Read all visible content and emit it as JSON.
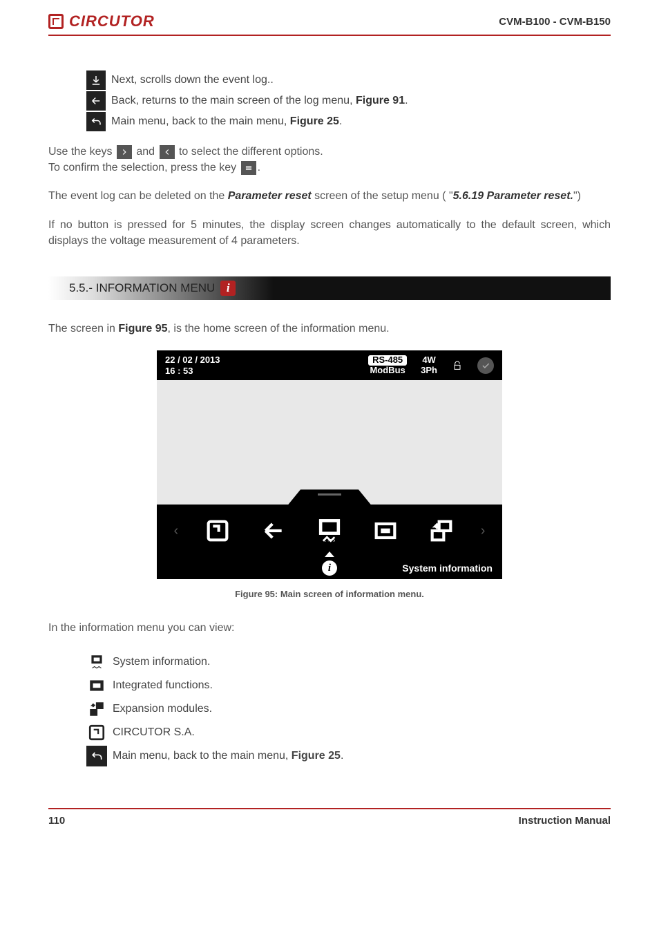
{
  "header": {
    "brand": "CIRCUTOR",
    "doc_id": "CVM-B100 - CVM-B150"
  },
  "icons_desc": {
    "next": " Next, scrolls down the event log..",
    "back_text_a": " Back, returns to the main screen of the log menu, ",
    "back_ref": "Figure 91",
    "back_text_b": ".",
    "menu_text_a": " Main menu, back to the main menu, ",
    "menu_ref": "Figure 25",
    "menu_text_b": "."
  },
  "keys_para": {
    "a": "Use the keys ",
    "b": " and ",
    "c": " to select the different options.",
    "d": "To confirm the selection, press the key ",
    "e": "."
  },
  "reset_para": {
    "a": "The event log can be deleted on the ",
    "b": "Parameter reset",
    "c": " screen of the setup menu ( \"",
    "d": "5.6.19 Parameter reset.",
    "e": "\")"
  },
  "timeout_para": "If no button is pressed for 5 minutes, the display screen changes automatically to the default screen, which displays the voltage measurement of 4 parameters.",
  "section": {
    "title": "5.5.- INFORMATION MENU ",
    "badge": "i"
  },
  "intro": {
    "a": "The screen in ",
    "b": "Figure 95",
    "c": ", is the home screen of the information menu."
  },
  "device": {
    "date": "22 / 02 / 2013",
    "time": "16 : 53",
    "rs_top": "RS-485",
    "rs_bot": "ModBus",
    "wires": "4W",
    "phase": "3Ph",
    "footer_label": "System information",
    "info_glyph": "i"
  },
  "caption": "Figure 95: Main screen of information menu.",
  "list_intro": "In the information menu you can view:",
  "list": {
    "sysinfo": " System information.",
    "integrated": " Integrated functions.",
    "expansion": " Expansion modules.",
    "circutor": " CIRCUTOR S.A.",
    "mainmenu_a": " Main menu, back to the main menu, ",
    "mainmenu_ref": "Figure 25",
    "mainmenu_b": "."
  },
  "footer": {
    "page": "110",
    "label": "Instruction Manual"
  }
}
